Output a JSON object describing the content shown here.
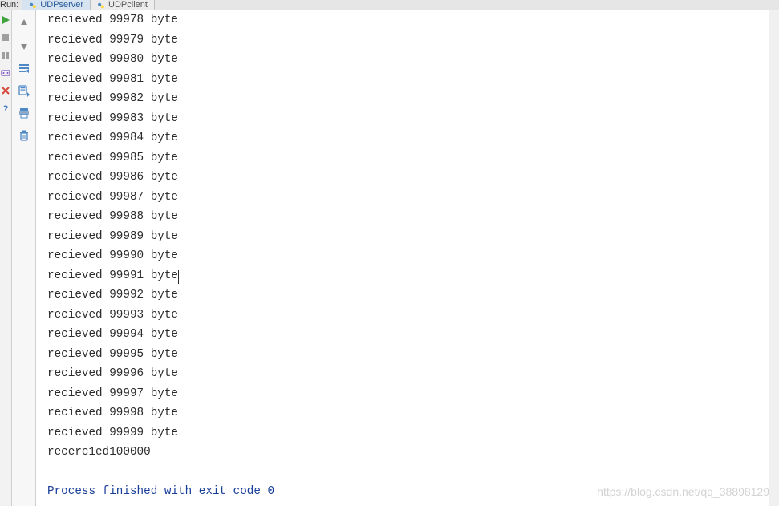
{
  "run_label": "Run:",
  "tabs": [
    {
      "id": "udpserver",
      "label": "UDPserver",
      "active": true
    },
    {
      "id": "udpclient",
      "label": "UDPclient",
      "active": false
    }
  ],
  "toolbar": {
    "up": "arrow-up-icon",
    "down": "arrow-down-icon",
    "wrap": "soft-wrap-icon",
    "scroll": "scroll-to-end-icon",
    "print": "print-icon",
    "clear": "clear-all-icon"
  },
  "gutter": {
    "run": "play-icon",
    "stop": "stop-icon",
    "pause": "pause-icon",
    "dump": "dump-threads-icon",
    "exit": "exit-icon",
    "help": "help-icon"
  },
  "console": {
    "lines": [
      "recieved 99978 byte",
      "recieved 99979 byte",
      "recieved 99980 byte",
      "recieved 99981 byte",
      "recieved 99982 byte",
      "recieved 99983 byte",
      "recieved 99984 byte",
      "recieved 99985 byte",
      "recieved 99986 byte",
      "recieved 99987 byte",
      "recieved 99988 byte",
      "recieved 99989 byte",
      "recieved 99990 byte",
      "recieved 99991 byte",
      "recieved 99992 byte",
      "recieved 99993 byte",
      "recieved 99994 byte",
      "recieved 99995 byte",
      "recieved 99996 byte",
      "recieved 99997 byte",
      "recieved 99998 byte",
      "recieved 99999 byte",
      "recerc1ed100000"
    ],
    "caret_line_index": 13,
    "finish_line": "Process finished with exit code 0"
  },
  "watermark": "https://blog.csdn.net/qq_38898129"
}
